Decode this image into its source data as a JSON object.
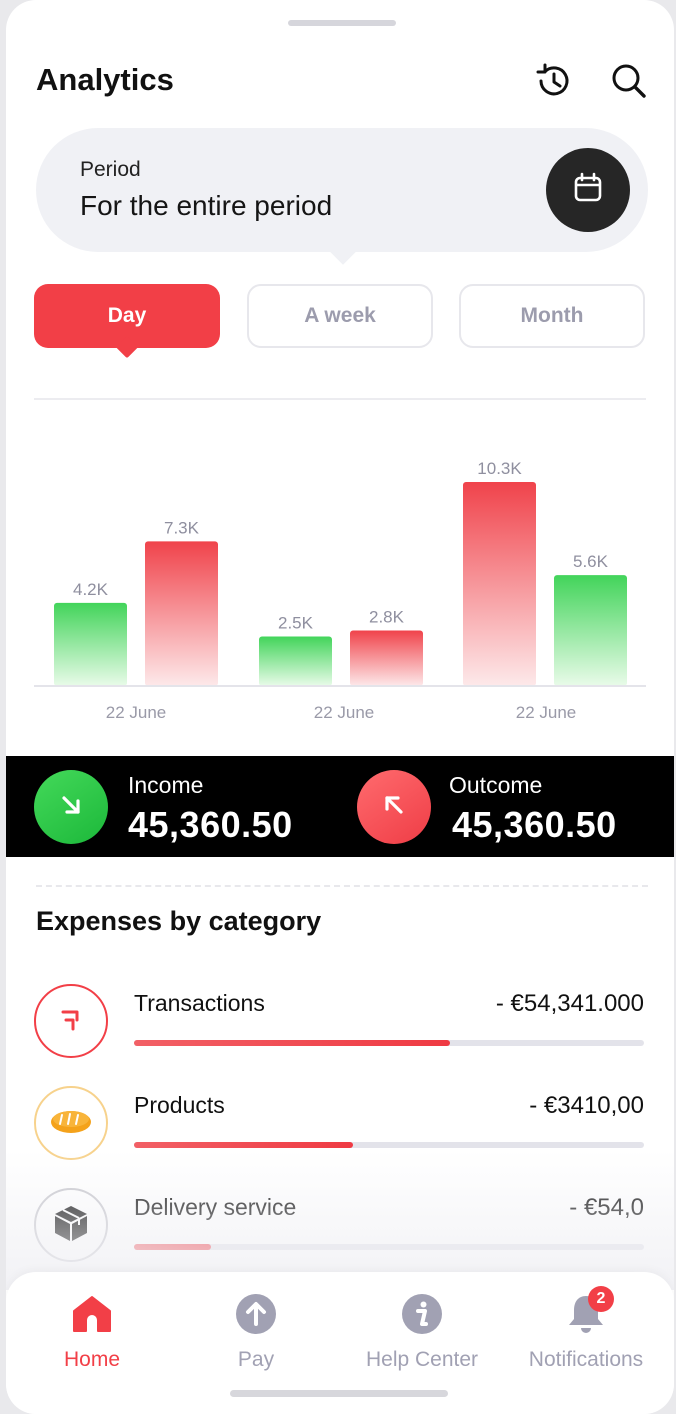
{
  "header": {
    "title": "Analytics"
  },
  "period": {
    "label": "Period",
    "value": "For the entire period"
  },
  "tabs": [
    {
      "label": "Day",
      "active": true
    },
    {
      "label": "A week",
      "active": false
    },
    {
      "label": "Month",
      "active": false
    }
  ],
  "chart_data": {
    "type": "bar",
    "categories": [
      "22 June",
      "22 June",
      "22 June"
    ],
    "series": [
      {
        "values": [
          4.2,
          2.5,
          10.3
        ],
        "labels": [
          "4.2K",
          "2.5K",
          "10.3K"
        ],
        "colors": [
          "#4bd863",
          "#4bd863",
          "#f0434b"
        ]
      },
      {
        "values": [
          7.3,
          2.8,
          5.6
        ],
        "labels": [
          "7.3K",
          "2.8K",
          "5.6K"
        ],
        "colors": [
          "#f0434b",
          "#f0434b",
          "#4bd863"
        ]
      }
    ],
    "ylim": [
      0,
      10.3
    ],
    "grid": false
  },
  "summary": {
    "income": {
      "label": "Income",
      "value": "45,360.50"
    },
    "outcome": {
      "label": "Outcome",
      "value": "45,360.50"
    }
  },
  "expenses": {
    "title": "Expenses by category",
    "items": [
      {
        "name": "Transactions",
        "amount": "- €54,341.000",
        "progress": 0.62,
        "icon": "transfer-arrows-icon",
        "accent": "#f23f47"
      },
      {
        "name": "Products",
        "amount": "- €3410,00",
        "progress": 0.43,
        "icon": "bread-icon",
        "accent": "#f7c46b"
      },
      {
        "name": "Delivery service",
        "amount": "- €54,0",
        "progress": 0.15,
        "icon": "package-icon",
        "accent": "#111111"
      }
    ]
  },
  "nav": {
    "items": [
      {
        "label": "Home",
        "icon": "home-icon",
        "active": true
      },
      {
        "label": "Pay",
        "icon": "pay-icon",
        "active": false
      },
      {
        "label": "Help Center",
        "icon": "info-icon",
        "active": false
      },
      {
        "label": "Notifications",
        "icon": "bell-icon",
        "active": false,
        "badge": "2"
      }
    ]
  },
  "colors": {
    "accent_red": "#f23f47",
    "accent_green": "#2fc84a",
    "muted": "#9c9cad"
  }
}
